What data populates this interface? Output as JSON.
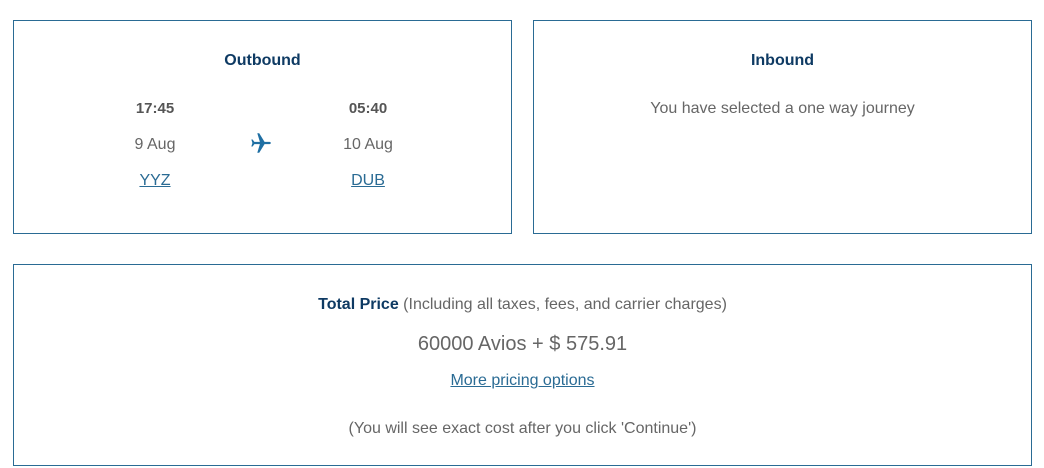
{
  "outbound": {
    "title": "Outbound",
    "departure": {
      "time": "17:45",
      "date": "9 Aug",
      "airport": "YYZ"
    },
    "arrival": {
      "time": "05:40",
      "date": "10 Aug",
      "airport": "DUB"
    },
    "icon": "airplane-icon"
  },
  "inbound": {
    "title": "Inbound",
    "message": "You have selected a one way journey"
  },
  "price": {
    "heading_strong": "Total Price",
    "heading_note": " (Including all taxes, fees, and carrier charges)",
    "amount": "60000 Avios + $ 575.91",
    "more_options_label": "More pricing options",
    "note": "(You will see exact cost after you click 'Continue')"
  },
  "colors": {
    "border": "#2a6b94",
    "title": "#0e3a63",
    "link": "#2a6b94",
    "text": "#666666"
  }
}
